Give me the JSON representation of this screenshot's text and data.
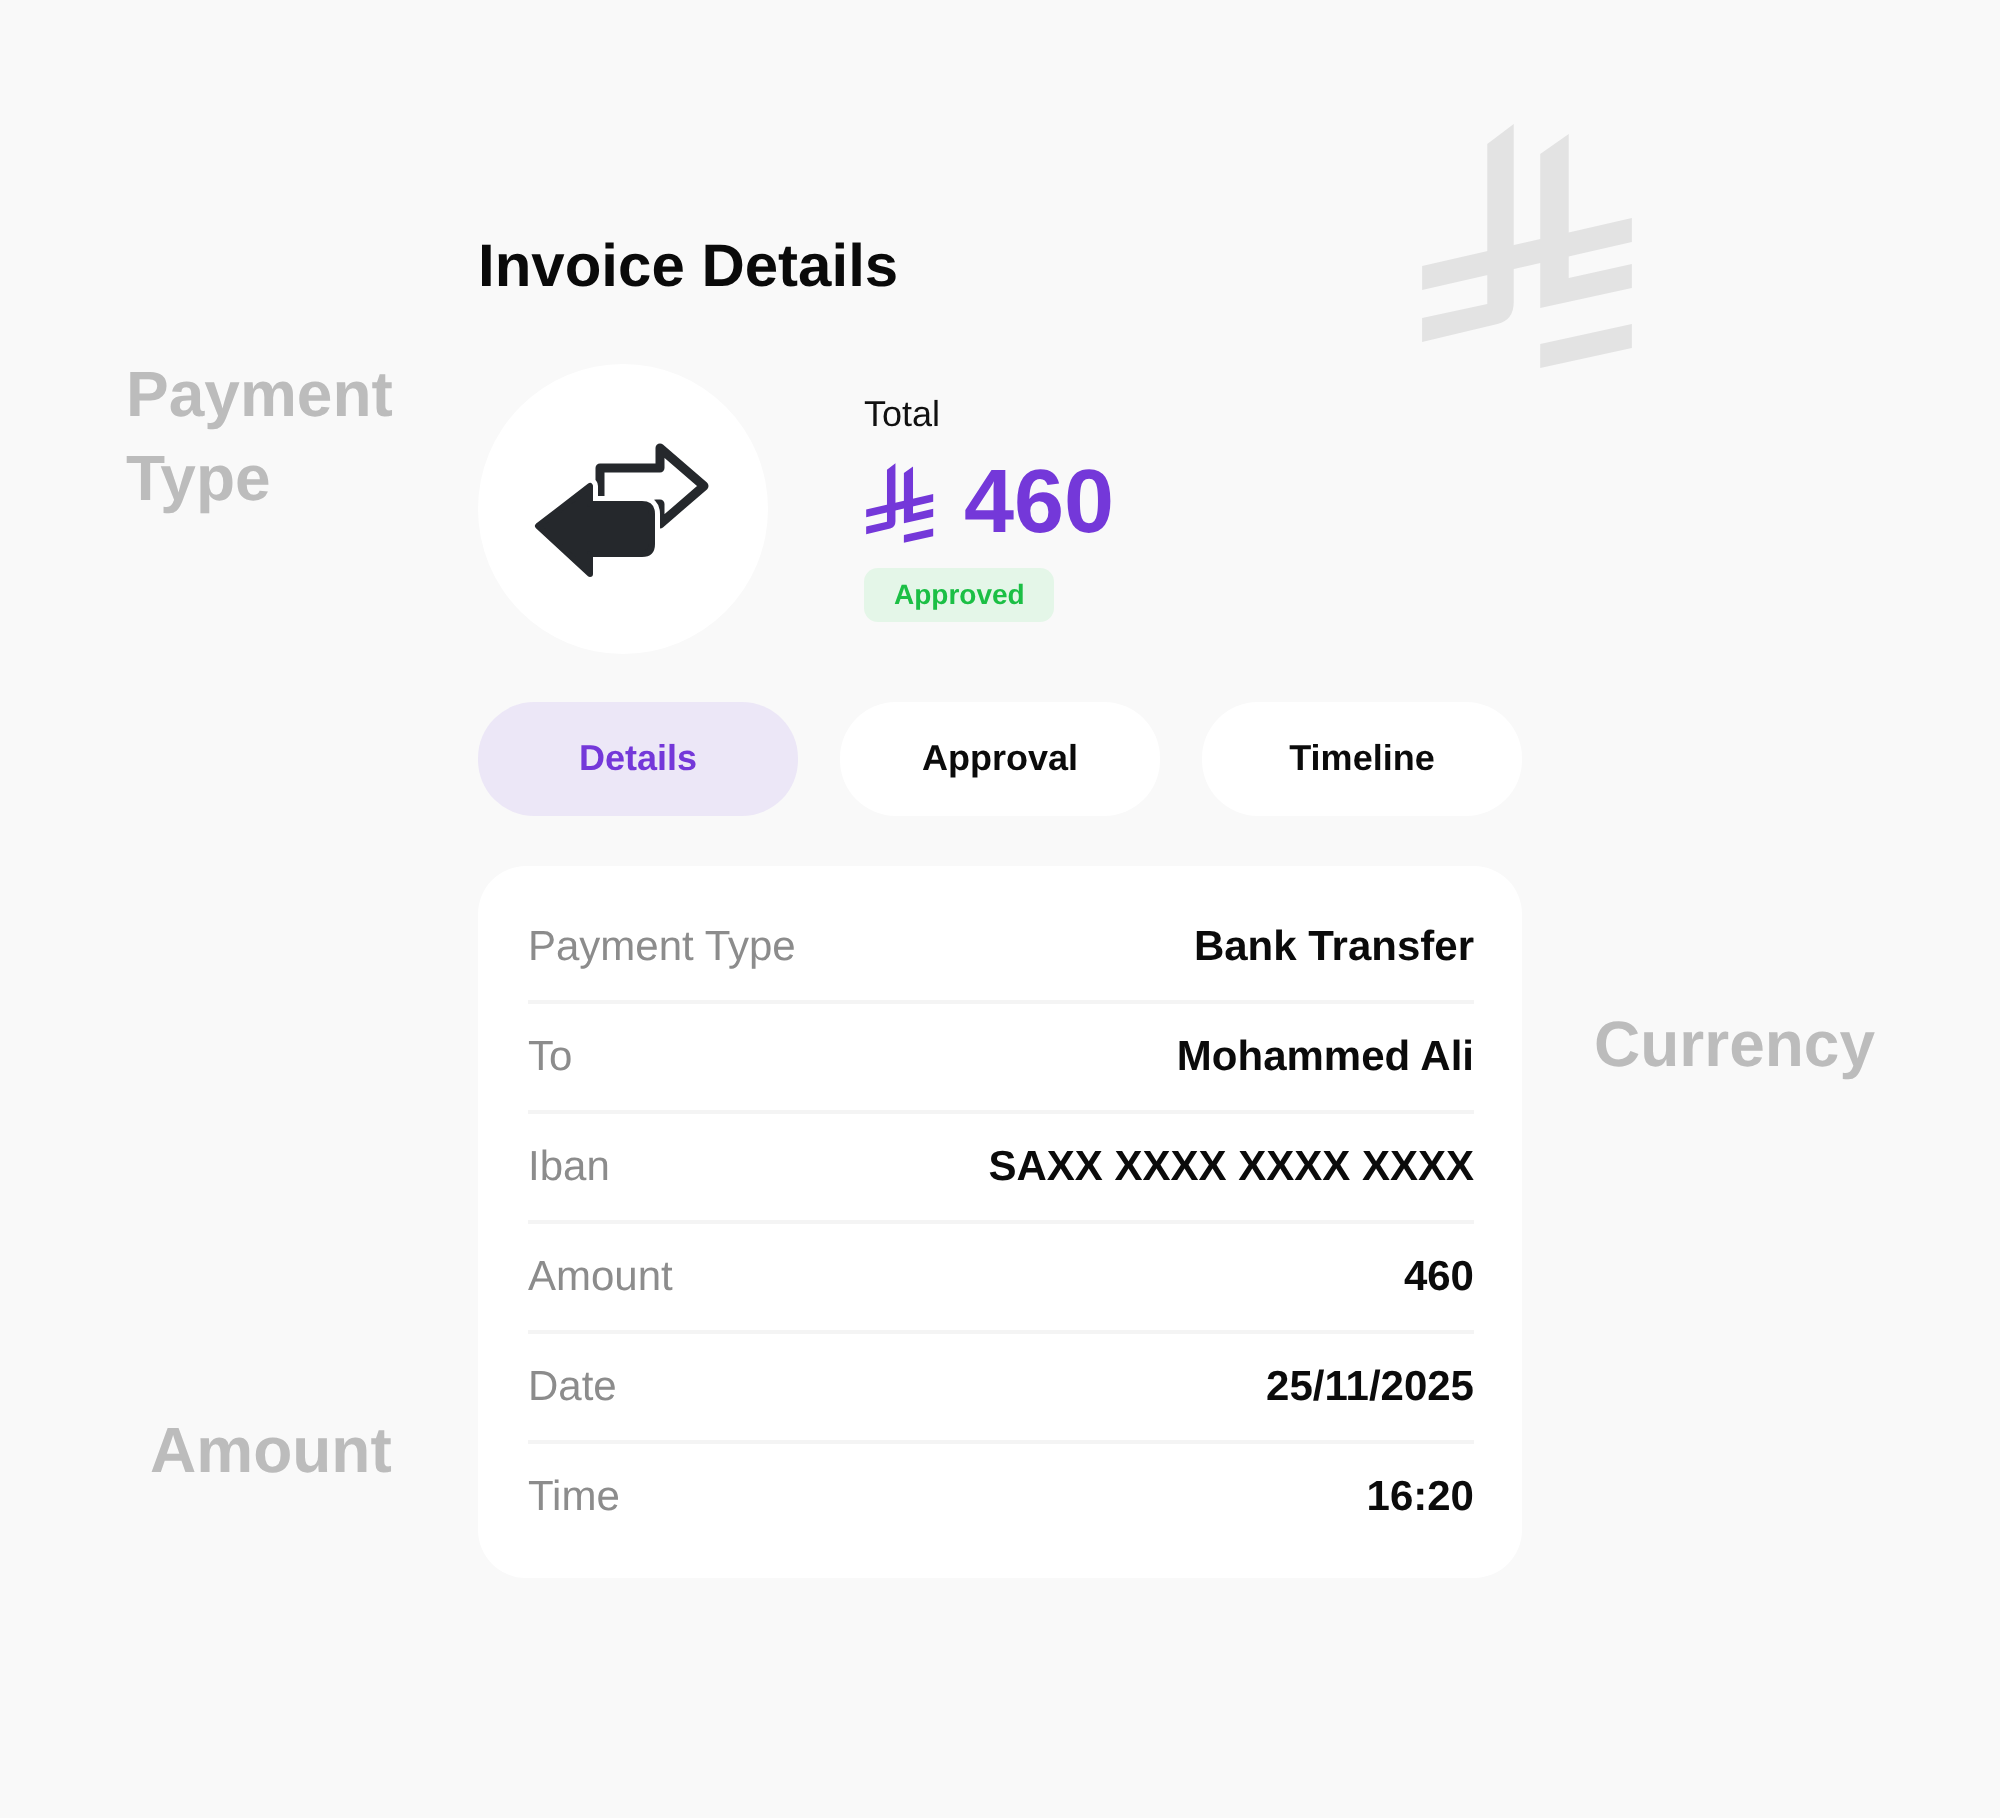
{
  "background_words": [
    {
      "text": "Payment Type"
    },
    {
      "text": "Currency"
    },
    {
      "text": "Amount"
    }
  ],
  "header": {
    "title": "Invoice Details"
  },
  "summary": {
    "label": "Total",
    "amount": "460",
    "status": "Approved"
  },
  "tabs": [
    {
      "label": "Details",
      "selected": true
    },
    {
      "label": "Approval",
      "selected": false
    },
    {
      "label": "Timeline",
      "selected": false
    }
  ],
  "details": [
    {
      "label": "Payment Type",
      "value": "Bank Transfer"
    },
    {
      "label": "To",
      "value": "Mohammed Ali"
    },
    {
      "label": "Iban",
      "value": "SAXX XXXX XXXX XXXX"
    },
    {
      "label": "Amount",
      "value": "460"
    },
    {
      "label": "Date",
      "value": "25/11/2025"
    },
    {
      "label": "Time",
      "value": "16:20"
    }
  ]
}
